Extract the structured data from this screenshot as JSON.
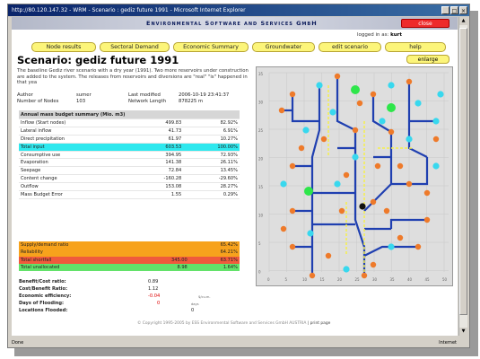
{
  "browser": {
    "title": "http://80.120.147.32 - WRM - Scenario : gediz future 1991 - Microsoft Internet Explorer",
    "status_left": "Done",
    "status_right": "Internet"
  },
  "header": {
    "company": "Environmental Software and Services GmbH",
    "close_label": "close",
    "login_prefix": "logged in as:",
    "login_user": "kurt"
  },
  "nav": {
    "items": [
      "Node results",
      "Sectoral Demand",
      "Economic Summary",
      "Groundwater",
      "edit scenario",
      "help"
    ],
    "enlarge": "enlarge"
  },
  "scenario": {
    "title": "Scenario: gediz future 1991",
    "description": "The baseline Gediz river scenario with a dry year (1991). Two more reservoirs under construction are added to the system. The releases from reservoirs and diversions are \"real\" \"is\" happened in that yea",
    "author_label": "Author",
    "author": "sumer",
    "modified_label": "Last modified",
    "modified": "2006-10-19 23:41:37",
    "nodes_label": "Number of Nodes",
    "nodes": "103",
    "network_label": "Network Length",
    "network": "878225 m"
  },
  "budget": {
    "header": "Annual mass budget summary (Mio. m3)",
    "rows": [
      {
        "label": "Inflow (Start nodes)",
        "value": "499.83",
        "pct": "82.92%"
      },
      {
        "label": "Lateral inflow",
        "value": "41.73",
        "pct": "6.91%"
      },
      {
        "label": "Direct precipitation",
        "value": "61.97",
        "pct": "10.27%"
      },
      {
        "label": "Total input",
        "value": "603.53",
        "pct": "100.00%",
        "highlight": true
      },
      {
        "label": "Consumptive use",
        "value": "394.95",
        "pct": "72.93%"
      },
      {
        "label": "Evaporation",
        "value": "141.38",
        "pct": "26.11%"
      },
      {
        "label": "Seepage",
        "value": "72.84",
        "pct": "13.45%"
      },
      {
        "label": "Content change",
        "value": "-160.28",
        "pct": "-29.60%"
      },
      {
        "label": "Outflow",
        "value": "153.08",
        "pct": "28.27%"
      },
      {
        "label": "Mass Budget Error",
        "value": "1.55",
        "pct": "0.29%"
      }
    ]
  },
  "summary": {
    "rows": [
      {
        "label": "Supply/demand ratio",
        "value": "",
        "pct": "65.42%",
        "color": "#f7a21c"
      },
      {
        "label": "Reliability",
        "value": "",
        "pct": "64.21%",
        "color": "#f7a21c"
      },
      {
        "label": "Total shortfall",
        "value": "345.00",
        "pct": "63.71%",
        "color": "#f05a3c"
      },
      {
        "label": "Total unallocated",
        "value": "8.98",
        "pct": "1.64%",
        "color": "#63e26a"
      }
    ]
  },
  "economics": {
    "benefit_label": "Benefit/Cost ratio:",
    "benefit": "0.89",
    "costbenefit_label": "Cost/Benefit Ratio:",
    "costbenefit": "1.12",
    "efficiency_label": "Economic efficiency:",
    "efficiency": "-0.04",
    "efficiency_unit": "$/cu.m.",
    "flooding_label": "Days of Flooding:",
    "flooding": "0",
    "flooding_unit": "days",
    "locations_label": "Locations Flooded:",
    "locations": "0"
  },
  "footer": {
    "text": "© Copyright 1995-2005 by   ESS   Environmental Software and Services GmbH AUSTRIA",
    "print": "| print page"
  },
  "map": {
    "x_ticks": [
      "0",
      "5",
      "10",
      "15",
      "20",
      "25",
      "30",
      "35",
      "40",
      "45",
      "50"
    ],
    "y_ticks": [
      "35",
      "30",
      "25",
      "20",
      "15",
      "10",
      "5",
      "0"
    ],
    "colors": {
      "river": "#1f3fb0",
      "node_orange": "#ee7a2a",
      "node_cyan": "#38d8ee",
      "node_green": "#2ee64a",
      "dash": "#f5ef4a"
    }
  }
}
